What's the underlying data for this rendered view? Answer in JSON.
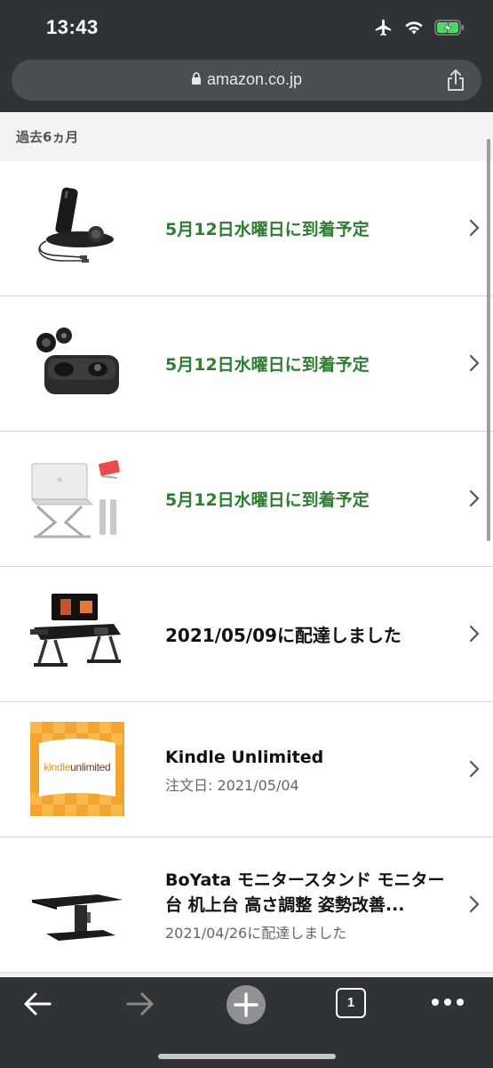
{
  "status_bar": {
    "time": "13:43"
  },
  "browser": {
    "url": "amazon.co.jp"
  },
  "section": {
    "title": "過去6ヵ月"
  },
  "orders": [
    {
      "status": "5月12日水曜日に到着予定",
      "thumb": "wireless-charger-image"
    },
    {
      "status": "5月12日水曜日に到着予定",
      "thumb": "earbuds-image"
    },
    {
      "status": "5月12日水曜日に到着予定",
      "thumb": "laptop-stand-image"
    },
    {
      "status": "2021/05/09に配達しました",
      "thumb": "bed-table-image"
    },
    {
      "title": "Kindle Unlimited",
      "sub": "注文日: 2021/05/04",
      "thumb": "kindle-unlimited-logo"
    },
    {
      "title": "BoYata モニタースタンド モニター台 机上台 高さ調整 姿勢改善...",
      "sub": "2021/04/26に配達しました",
      "thumb": "monitor-stand-image"
    }
  ],
  "kindle_logo": {
    "kindle": "kindle",
    "unlimited": "unlimited"
  },
  "toolbar": {
    "tab_count": "1"
  },
  "colors": {
    "delivery_green": "#2e7d32",
    "chrome_bg": "#303336",
    "battery_green": "#4cd964"
  }
}
